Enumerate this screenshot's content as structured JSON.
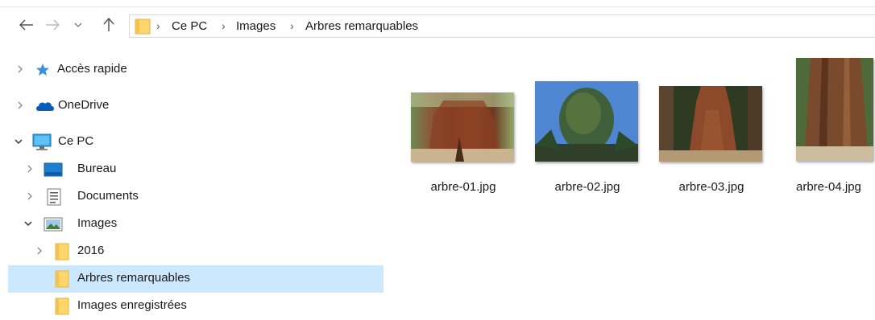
{
  "breadcrumb": {
    "items": [
      "Ce PC",
      "Images",
      "Arbres remarquables"
    ],
    "separator": "›"
  },
  "navpane": {
    "items": [
      {
        "label": "Accès rapide",
        "icon": "star-icon"
      },
      {
        "label": "OneDrive",
        "icon": "cloud-icon"
      },
      {
        "label": "Ce PC",
        "icon": "computer-icon"
      },
      {
        "label": "Bureau",
        "icon": "desktop-folder-icon"
      },
      {
        "label": "Documents",
        "icon": "documents-folder-icon"
      },
      {
        "label": "Images",
        "icon": "images-folder-icon"
      },
      {
        "label": "2016",
        "icon": "folder-icon"
      },
      {
        "label": "Arbres remarquables",
        "icon": "folder-icon",
        "selected": true
      },
      {
        "label": "Images enregistrées",
        "icon": "folder-icon"
      }
    ]
  },
  "files": [
    {
      "name": "arbre-01.jpg"
    },
    {
      "name": "arbre-02.jpg"
    },
    {
      "name": "arbre-03.jpg"
    },
    {
      "name": "arbre-04.jpg"
    }
  ],
  "colors": {
    "selection": "#cce8ff",
    "folder": "#ffd66b",
    "accent": "#0078d7"
  }
}
